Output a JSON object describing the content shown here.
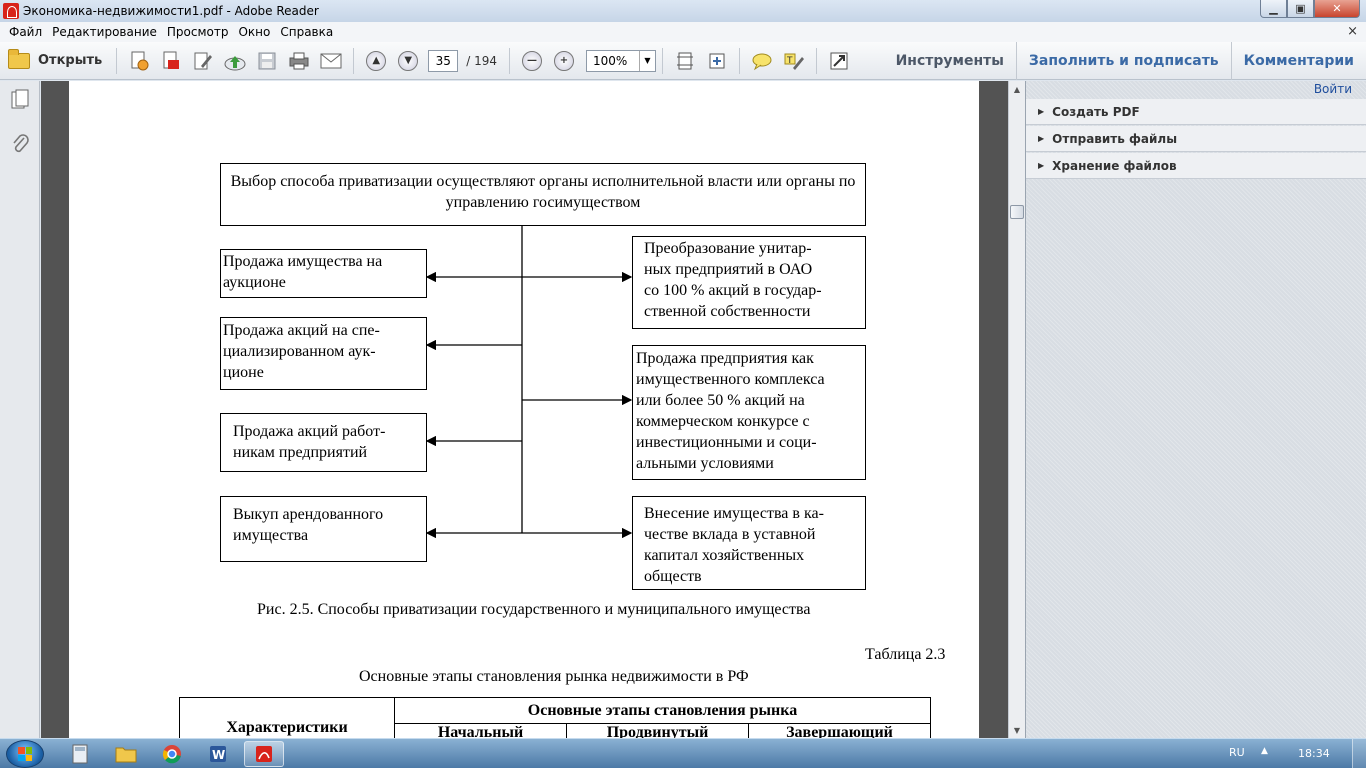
{
  "window": {
    "title": "Экономика-недвижимости1.pdf - Adobe Reader"
  },
  "menubar": {
    "items": [
      "Файл",
      "Редактирование",
      "Просмотр",
      "Окно",
      "Справка"
    ],
    "close_glyph": "×"
  },
  "toolbar": {
    "open_label": "Открыть",
    "page_current": "35",
    "page_total": "/ 194",
    "zoom": "100%",
    "tools_label": "Инструменты",
    "fill_sign_label": "Заполнить и подписать",
    "comments_label": "Комментарии"
  },
  "right_pane": {
    "signin": "Войти",
    "sections": [
      "Создать PDF",
      "Отправить файлы",
      "Хранение файлов"
    ]
  },
  "document": {
    "diagram": {
      "top": "Выбор способа приватизации осуществляют органы исполнительной власти или органы по управлению госимуществом",
      "left": [
        "Продажа имущества на аукционе",
        "Продажа акций на специализированном аукционе",
        "Продажа акций работникам предприятий",
        "Выкуп арендованного имущества"
      ],
      "left_lines": [
        [
          "Продажа имущества на",
          "аукционе"
        ],
        [
          "Продажа акций на спе-",
          "циализированном аук-",
          "ционе"
        ],
        [
          "Продажа акций работ-",
          "никам предприятий"
        ],
        [
          "Выкуп арендованного",
          "имущества"
        ]
      ],
      "right_lines": [
        [
          "Преобразование унитар-",
          "ных предприятий в ОАО",
          "со 100 % акций в государ-",
          "ственной собственности"
        ],
        [
          "Продажа предприятия как",
          "имущественного комплекса",
          "или более 50 % акций на",
          "коммерческом конкурсе с",
          "инвестиционными и соци-",
          "альными условиями"
        ],
        [
          "Внесение имущества в ка-",
          "честве вклада в уставной",
          "капитал хозяйственных",
          "обществ"
        ]
      ]
    },
    "caption": "Рис. 2.5. Способы приватизации государственного и муниципального имущества",
    "table_label": "Таблица 2.3",
    "table_title": "Основные этапы становления рынка недвижимости в РФ",
    "table": {
      "col_header": "Характеристики",
      "group_header": "Основные этапы становления рынка",
      "stages": [
        "Начальный",
        "Продвинутый",
        "Завершающий"
      ]
    }
  },
  "taskbar": {
    "lang": "RU",
    "clock": "18:34"
  },
  "colors": {
    "accent_blue": "#3b6aa6",
    "doc_background": "#535353",
    "taskbar": "#4c79a6"
  }
}
